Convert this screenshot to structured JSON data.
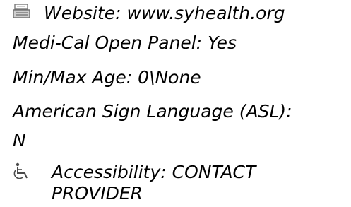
{
  "provider_details": {
    "website": {
      "icon": "keyboard-icon",
      "text": "Website: www.syhealth.org"
    },
    "medi_cal": "Medi-Cal Open Panel: Yes",
    "age_range": "Min/Max Age: 0\\None",
    "asl_label": "American Sign Language (ASL):",
    "asl_value": "N",
    "accessibility": {
      "icon": "wheelchair-icon",
      "line1": "Accessibility: CONTACT",
      "line2": "PROVIDER"
    }
  }
}
